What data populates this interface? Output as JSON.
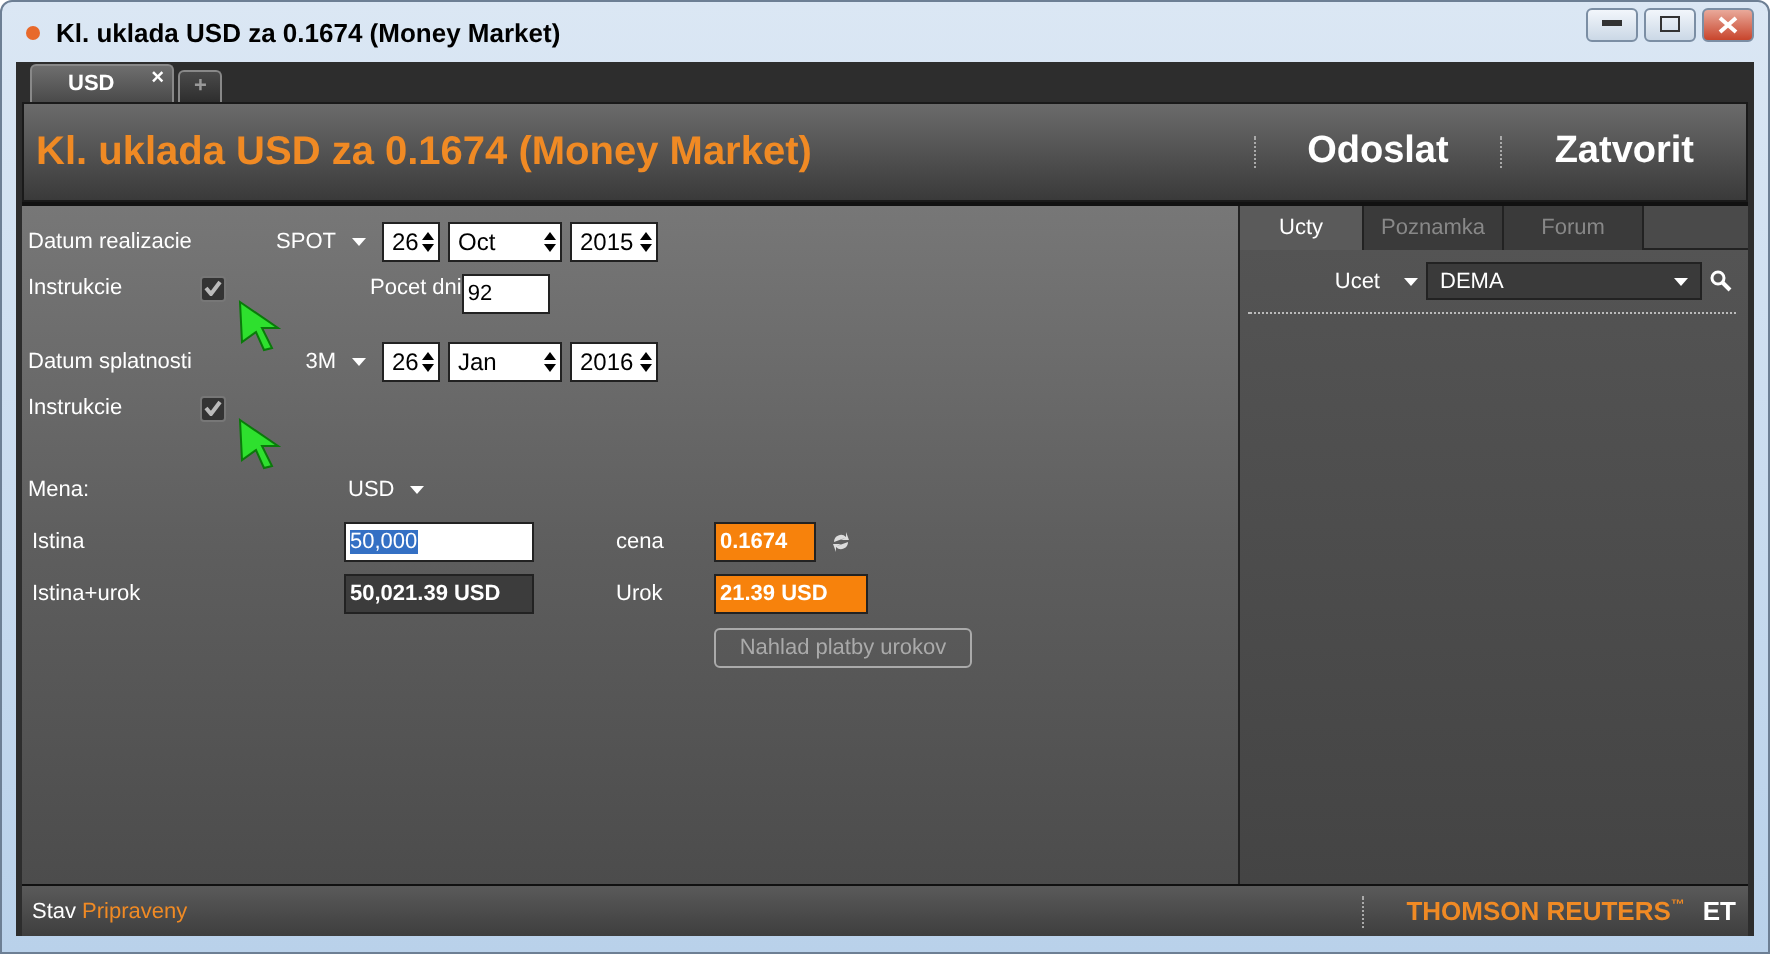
{
  "window": {
    "title": "Kl. uklada USD za 0.1674 (Money Market)"
  },
  "tabs": [
    {
      "label": "USD",
      "selected": true,
      "close": "×"
    },
    {
      "label": "+",
      "selected": false
    }
  ],
  "header": {
    "title": "Kl. uklada USD za 0.1674 (Money Market)",
    "actions": [
      "Odoslat",
      "Zatvorit"
    ]
  },
  "form": {
    "value_date": {
      "label": "Datum realizacie",
      "tenor": "SPOT",
      "day": "26",
      "month": "Oct",
      "year": "2015"
    },
    "value_instructions": {
      "label": "Instrukcie",
      "checked": true
    },
    "days": {
      "label": "Pocet dni",
      "value": "92"
    },
    "maturity_date": {
      "label": "Datum splatnosti",
      "tenor": "3M",
      "day": "26",
      "month": "Jan",
      "year": "2016"
    },
    "maturity_instructions": {
      "label": "Instrukcie",
      "checked": true
    },
    "currency": {
      "label": "Mena:",
      "value": "USD"
    },
    "principal": {
      "label": "Istina",
      "value": "50,000"
    },
    "rate": {
      "label": "cena",
      "value": "0.1674"
    },
    "total": {
      "label": "Istina+urok",
      "value": "50,021.39 USD"
    },
    "interest": {
      "label": "Urok",
      "value": "21.39 USD"
    },
    "button": {
      "label": "Nahlad platby urokov",
      "disabled": true
    }
  },
  "side_panel": {
    "tabs": [
      {
        "label": "Ucty",
        "selected": true
      },
      {
        "label": "Poznamka",
        "selected": false
      },
      {
        "label": "Forum",
        "selected": false
      }
    ],
    "account": {
      "label": "Ucet",
      "value": "DEMA"
    }
  },
  "status_bar": {
    "label": "Stav",
    "value": "Pripraveny",
    "brand": "THOMSON REUTERS",
    "brand_mark": "™",
    "badge": "ET"
  }
}
